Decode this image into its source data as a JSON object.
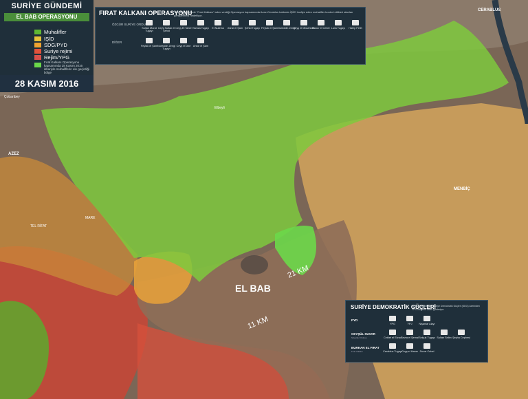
{
  "legend": {
    "title": "SURİYE GÜNDEMİ",
    "subtitle": "EL BAB OPERASYONU",
    "items": [
      {
        "label": "Muhalifler",
        "color": "#5fb832"
      },
      {
        "label": "IŞİD",
        "color": "#e8c33a"
      },
      {
        "label": "SDG/PYD",
        "color": "#f0a430"
      },
      {
        "label": "Suriye rejimi",
        "color": "#e2523a"
      },
      {
        "label": "Rejim/YPG",
        "color": "#d9504a"
      }
    ],
    "note": "Fırat Kalkanı Operasyonu kapsamında 28 Kasım 2016 itibariyle muhaliflerin ele geçirdiği bölge",
    "note_color": "#6bd84a",
    "date": "28 KASIM 2016"
  },
  "fk_panel": {
    "title": "FIRAT KALKANI OPERASYONU",
    "desc": "TSK öncülüğünde \"Fırat Kalkanı\" adını verdiği Operasyon kapsamında Azez-Cerablus hattında İŞİD'i tasfiye eden muhalifler kontrol ettikleri alanları genişletmeyi hedefliyor.",
    "row1_label": "ÖZGÜR SURİYE ORDUSU",
    "row2_label": "DİĞER",
    "groups_row1": [
      "Sultan Murat Tugayı",
      "Ceyş Sultan el Şehid",
      "Ceyş El Tahrir",
      "Hamza Tugayı",
      "El Nukhba",
      "Ahrar el Şam",
      "Şehid Tugayı",
      "Feylak el Şam",
      "Nureddin Zengi",
      "Ceyş el Mücahidin",
      "Sukur el Cebel",
      "Lıwa Tugayı",
      "Halep Fetih"
    ],
    "groups_row2": [
      "Feylak el Şam",
      "Nureddin Zengi Tugayı",
      "Ceyş el İzze",
      "Ahrar el Şam"
    ]
  },
  "sdg_panel": {
    "title": "SURİYE DEMOKRATİK GÜÇLERİ",
    "desc": "El Bab'ı hedefleyen Suriye Demokratik Güçleri (SDG) üzerinden YPG bölgede varlık gösteriyor.",
    "rows": [
      {
        "label": "PYD",
        "groups": [
          "YPG",
          "YPJ",
          "Nişanlar Alayı"
        ]
      },
      {
        "label": "CEYŞÜL SUVAR",
        "sub": "Süvariler Ordusu",
        "groups": [
          "Ceblet el Ekrad",
          "Sevra el Şemal",
          "Selçuk Tugayı",
          "Sultan Selim",
          "Şeyha Cephesi"
        ]
      },
      {
        "label": "BURKAN EL FIRAT",
        "sub": "Fırat Volkanı",
        "groups": [
          "Cerablus Tugayı",
          "Ceyş el Havar",
          "Suvar Cebel"
        ]
      }
    ]
  },
  "places": {
    "cerablus": "CERABLUS",
    "azez": "AZEZ",
    "menbic": "MENBİÇ",
    "el_bab": "EL BAB",
    "tel_rifat": "TEL RİFAT",
    "mare": "MARE",
    "cobanbey": "Çobanbey",
    "elbeyli": "Elbeyli",
    "dist_21": "21 KM",
    "dist_11": "11 KM"
  },
  "colors": {
    "rebels": "#7ec93d",
    "rebels_dark": "#5ea82e",
    "isid": "#d9b05f",
    "sdg": "#e5a63a",
    "regime": "#d9483a",
    "ypg_regime": "#b84a4a",
    "brown": "#8a6a55",
    "panel": "#1f2f3a"
  }
}
